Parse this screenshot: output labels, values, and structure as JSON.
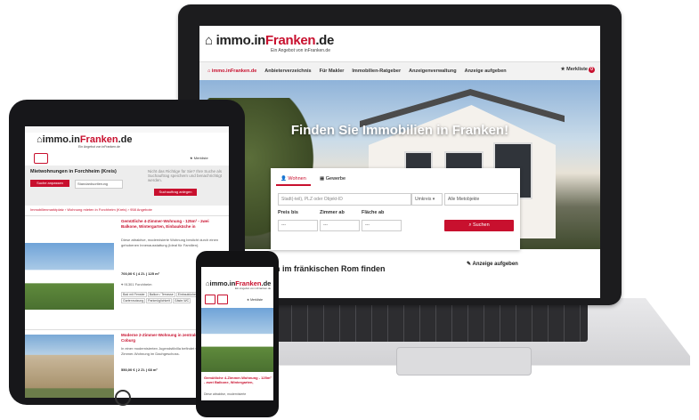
{
  "laptop": {
    "logo_main": "immo.in",
    "logo_brand": "Franken",
    "logo_tld": ".de",
    "logo_sub": "Ein Angebot von inFranken.de",
    "nav": [
      {
        "label": "immo.inFranken.de"
      },
      {
        "label": "Anbieterverzeichnis"
      },
      {
        "label": "Für Makler"
      },
      {
        "label": "Immobilien-Ratgeber"
      },
      {
        "label": "Anzeigenverwaltung"
      },
      {
        "label": "Anzeige aufgeben"
      }
    ],
    "merkliste": "Merkliste",
    "merkliste_count": "0",
    "hero_title": "Finden Sie Immobilien in Franken!",
    "search": {
      "tab_wohnen": "Wohnen",
      "tab_gewerbe": "Gewerbe",
      "location_placeholder": "Stadt(-teil), PLZ oder Objekt-ID",
      "radius": "Umkreis",
      "type": "Alle Mietobjekte",
      "price_label": "Preis bis",
      "rooms_label": "Zimmer ab",
      "area_label": "Fläche ab",
      "dropdown_value": "---",
      "submit": "Suchen"
    },
    "section_title": "en im fränkischen Rom finden",
    "anzeige_aufgeben": "Anzeige aufgeben"
  },
  "tablet": {
    "logo_main": "immo.in",
    "logo_brand": "Franken",
    "logo_tld": ".de",
    "logo_sub": "Ein Angebot von inFranken.de",
    "merkliste": "Merkliste",
    "results_heading": "Mietwohnungen in Forchheim (Kreis)",
    "search_button": "Suche anpassen",
    "sort_select": "Standardsortierung",
    "side_text": "Nicht das Richtige für Sie? Ihre Suche als Suchauftrag speichern und benachrichtigt werden.",
    "save_button": "Suchauftrag anlegen",
    "breadcrumb": "Immobilienmarktplatz › Wohnung mieten in Forchheim (Kreis) › 958 Angebote",
    "listings": [
      {
        "title": "Gemütliche 4-Zimmer-Wohnung - 125m² - zwei Balkone, Wintergarten, Einbauküche in",
        "text": "Diese attraktive, modernisierte Wohnung besticht durch einen gehobenen Innenausstattung (Ideal für Familien).",
        "price": "700,00 €",
        "rooms": "4 Zi.",
        "area": "125 m²",
        "location": "91301 Forchheim",
        "tags": [
          "Bad mit Fenster",
          "Balkon / Terrasse",
          "Einbauküche",
          "Gartennutzung",
          "Parkmöglichkeit",
          "Gäste-WC"
        ]
      },
      {
        "title": "Moderne 2-Zimmer-Wohnung in zentraler Lage von Coburg",
        "text": "In einer modernisierten Jugendstilvilla befindet sich diese 2-Zimmer-Wohnung im Dachgeschoss.",
        "price": "550,00 €",
        "rooms": "2 Zi.",
        "area": "68 m²"
      }
    ]
  },
  "phone": {
    "logo_main": "immo.in",
    "logo_brand": "Franken",
    "logo_tld": ".de",
    "logo_sub": "Ein Angebot von inFranken.de",
    "merkliste": "Merkliste",
    "listing_title": "Gemütliche 4-Zimmer-Wohnung - 125m² - zwei Balkone, Wintergarten,",
    "listing_text": "Diese attraktive, modernisierte"
  },
  "colors": {
    "brand_red": "#c8102e"
  }
}
